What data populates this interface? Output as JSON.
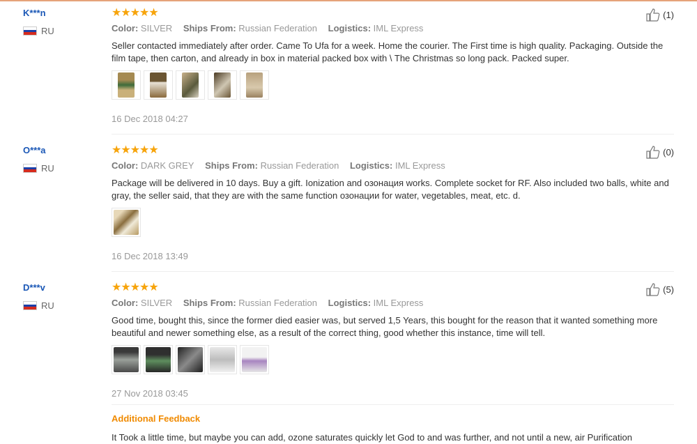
{
  "labels": {
    "color": "Color:",
    "ships_from": "Ships From:",
    "logistics": "Logistics:"
  },
  "stars": "★★★★★",
  "reviews": [
    {
      "user": "K***n",
      "country": "RU",
      "color": "SILVER",
      "ships_from": "Russian Federation",
      "logistics": "IML Express",
      "text": "Seller contacted immediately after order. Came To Ufa for a week. Home the courier. The First time is high quality. Packaging. Outside the film tape, then carton, and already in box in material packed box with \\ The Christmas so long pack. Packed super.",
      "date": "16 Dec 2018 04:27",
      "likes": "(1)"
    },
    {
      "user": "O***a",
      "country": "RU",
      "color": "DARK GREY",
      "ships_from": "Russian Federation",
      "logistics": "IML Express",
      "text": "Package will be delivered in 10 days. Buy a gift. Ionization and озонация works. Complete socket for RF. Also included two balls, white and gray, the seller said, that they are with the same function озонации for water, vegetables, meat, etc. d.",
      "date": "16 Dec 2018 13:49",
      "likes": "(0)"
    },
    {
      "user": "D***v",
      "country": "RU",
      "color": "SILVER",
      "ships_from": "Russian Federation",
      "logistics": "IML Express",
      "text": "Good time, bought this, since the former died easier was, but served 1,5 Years, this bought for the reason that it wanted something more beautiful and newer something else, as a result of the correct thing, good whether this instance, time will tell.",
      "date": "27 Nov 2018 03:45",
      "likes": "(5)"
    }
  ],
  "additional_feedback": {
    "title": "Additional Feedback",
    "text": "It Took a little time, but maybe you can add, ozone saturates quickly let God to and was further, and not until a new, air Purification"
  },
  "colors": {
    "accent": "#f7a40b",
    "username": "#1a57b6",
    "feedback_title": "#f08a00"
  }
}
